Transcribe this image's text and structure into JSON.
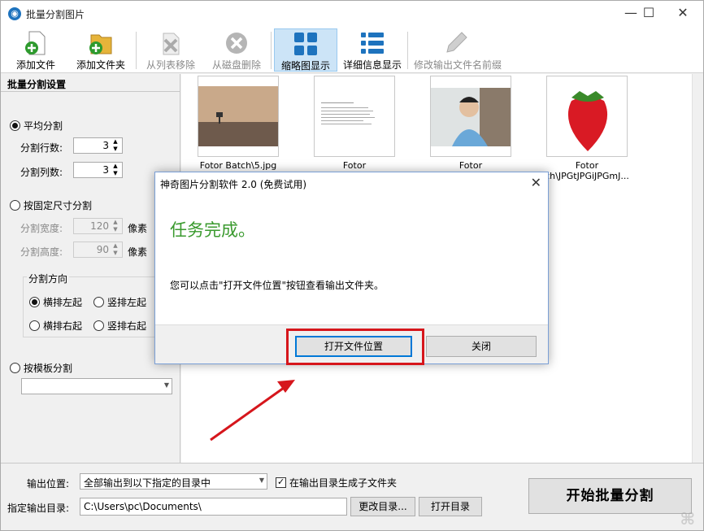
{
  "window": {
    "title": "批量分割图片",
    "controls": {
      "minimize": "—",
      "maximize": "☐",
      "close": "✕"
    }
  },
  "toolbar": {
    "add_file": "添加文件",
    "add_folder": "添加文件夹",
    "remove_from_list": "从列表移除",
    "delete_from_disk": "从磁盘删除",
    "thumbnail_view": "缩略图显示",
    "detail_view": "详细信息显示",
    "rename_prefix": "修改输出文件名前缀"
  },
  "settings": {
    "header": "批量分割设置",
    "even_split": "平均分割",
    "rows_label": "分割行数:",
    "rows_value": "3",
    "cols_label": "分割列数:",
    "cols_value": "3",
    "fixed_split": "按固定尺寸分割",
    "width_label": "分割宽度:",
    "width_value": "120",
    "height_label": "分割高度:",
    "height_value": "90",
    "unit": "像素",
    "direction_title": "分割方向",
    "dir_h_left": "横排左起",
    "dir_v_left": "竖排左起",
    "dir_h_right": "横排右起",
    "dir_v_right": "竖排右起",
    "template_split": "按模板分割"
  },
  "thumbnails": [
    {
      "caption": "Fotor Batch\\5.jpg"
    },
    {
      "caption": "Fotor"
    },
    {
      "caption": "Fotor"
    },
    {
      "caption": "Fotor\nch\\JPGtJPGiJPGmJ..."
    }
  ],
  "output": {
    "location_label": "输出位置:",
    "location_value": "全部输出到以下指定的目录中",
    "subfolder_label": "在输出目录生成子文件夹",
    "dir_label": "指定输出目录:",
    "dir_value": "C:\\Users\\pc\\Documents\\",
    "change_dir": "更改目录...",
    "open_dir": "打开目录",
    "start": "开始批量分割"
  },
  "dialog": {
    "title": "神奇图片分割软件 2.0 (免费试用)",
    "heading": "任务完成。",
    "message": "您可以点击\"打开文件位置\"按钮查看输出文件夹。",
    "open_location": "打开文件位置",
    "close": "关闭"
  },
  "colors": {
    "accent": "#0078d7",
    "success": "#3a9a2e",
    "highlight": "#d6161c"
  }
}
